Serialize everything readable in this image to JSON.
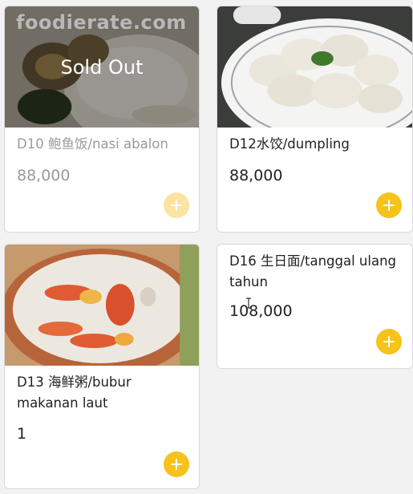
{
  "watermark": "foodierate.com",
  "sold_out_label": "Sold Out",
  "accent_color": "#f6c21c",
  "items": [
    {
      "name": "D10 鲍鱼饭/nasi abalon",
      "price": "88,000",
      "sold_out": true
    },
    {
      "name": "D12水饺/dumpling",
      "price": "88,000",
      "sold_out": false
    },
    {
      "name": "D13 海鲜粥/bubur makanan laut",
      "price": "1",
      "sold_out": false
    },
    {
      "name": "D16 生日面/tanggal ulang tahun",
      "price": "108,000",
      "sold_out": false
    }
  ]
}
